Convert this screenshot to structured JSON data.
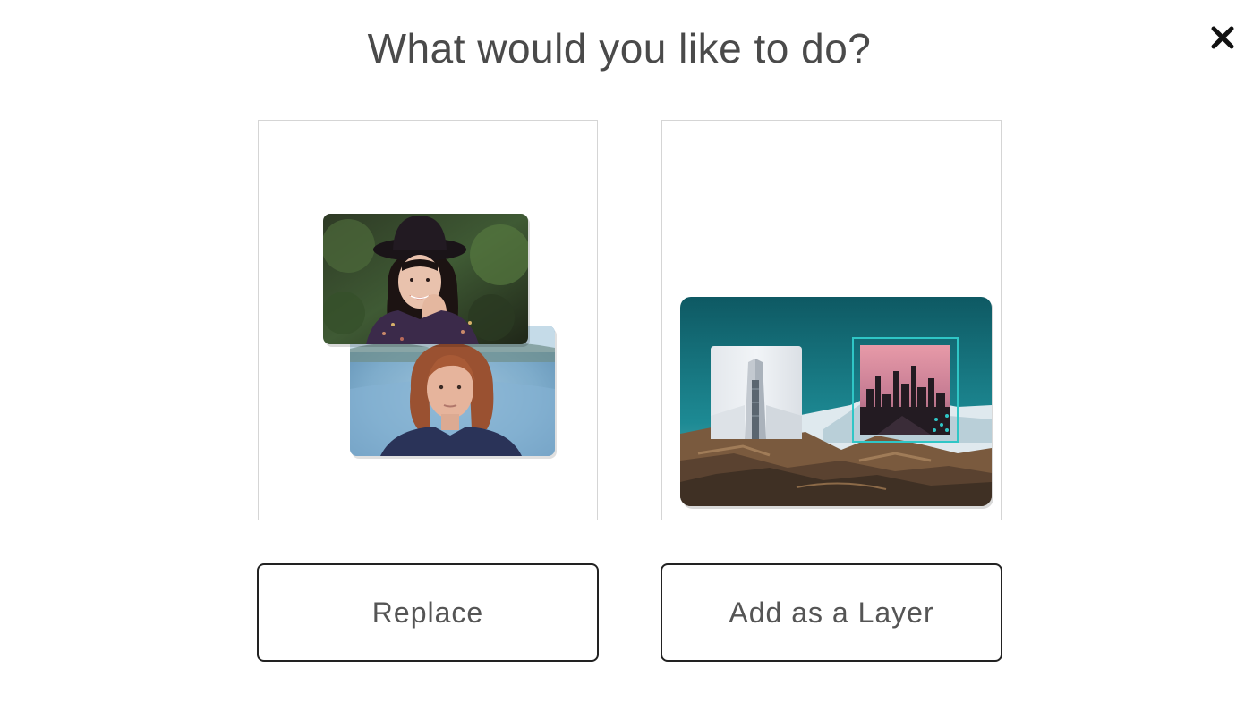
{
  "dialog": {
    "title": "What would you like to do?",
    "close_icon": "close-icon"
  },
  "options": [
    {
      "illustration": "replace-photos-illustration",
      "button_label": "Replace"
    },
    {
      "illustration": "add-layer-illustration",
      "button_label": "Add as a Layer"
    }
  ],
  "colors": {
    "title_text": "#4a4a4a",
    "button_border": "#222222",
    "card_border": "#d5d5d5",
    "selection_accent": "#2fc6c6"
  }
}
